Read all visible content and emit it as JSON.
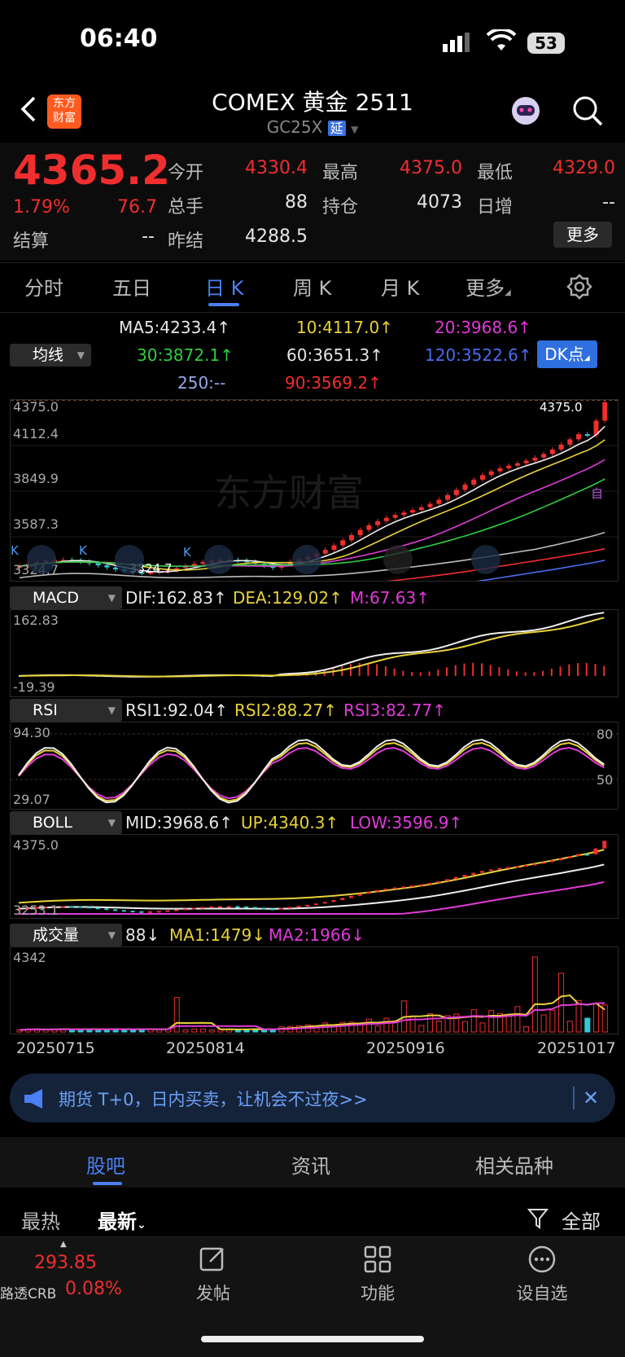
{
  "status": {
    "time": "06:40",
    "battery": "53"
  },
  "header": {
    "title": "COMEX 黄金 2511",
    "code": "GC25X",
    "delay_badge": "延",
    "logo_text": "东方\n财富"
  },
  "quote": {
    "last": "4365.2",
    "change_pct": "1.79%",
    "change": "76.7",
    "open_label": "今开",
    "open": "4330.4",
    "high_label": "最高",
    "high": "4375.0",
    "low_label": "最低",
    "low": "4329.0",
    "volume_label": "总手",
    "volume": "88",
    "oi_label": "持仓",
    "oi": "4073",
    "daily_inc_label": "日增",
    "daily_inc": "--",
    "settle_label": "结算",
    "settle": "--",
    "prev_settle_label": "昨结",
    "prev_settle": "4288.5",
    "more_button": "更多"
  },
  "tabs": [
    "分时",
    "五日",
    "日 K",
    "周 K",
    "月 K",
    "更多"
  ],
  "active_tab": "日 K",
  "ma": {
    "selector": "均线",
    "ma5": "MA5:4233.4↑",
    "ma10": "10:4117.0↑",
    "ma20": "20:3968.6↑",
    "ma30": "30:3872.1↑",
    "ma60": "60:3651.3↑",
    "ma120": "120:3522.6↑",
    "ma250": "250:--",
    "ma90": "90:3569.2↑",
    "dk_button": "DK点"
  },
  "main_chart": {
    "ticks": [
      "4375.0",
      "4112.4",
      "3849.9",
      "3587.3",
      "3324.7"
    ],
    "high_marker": "4375.0",
    "low_marker": "3324.7",
    "watermark": "东方财富",
    "tag_self": "自",
    "k_tags": [
      "K",
      "K",
      "K"
    ]
  },
  "macd": {
    "selector": "MACD",
    "dif": "DIF:162.83↑",
    "dea": "DEA:129.02↑",
    "m": "M:67.63↑",
    "ticks": [
      "162.83",
      "-19.39"
    ]
  },
  "rsi": {
    "selector": "RSI",
    "rsi1": "RSI1:92.04↑",
    "rsi2": "RSI2:88.27↑",
    "rsi3": "RSI3:82.77↑",
    "ticks": [
      "94.30",
      "29.07"
    ],
    "right_ticks": [
      "80",
      "50"
    ]
  },
  "boll": {
    "selector": "BOLL",
    "mid": "MID:3968.6↑",
    "up": "UP:4340.3↑",
    "low": "LOW:3596.9↑",
    "ticks": [
      "4375.0",
      "3253.1"
    ]
  },
  "vol": {
    "selector": "成交量",
    "v": "88↓",
    "ma1": "MA1:1479↓",
    "ma2": "MA2:1966↓",
    "ticks": [
      "4342"
    ]
  },
  "dates": [
    "20250715",
    "20250814",
    "20250916",
    "20251017"
  ],
  "banner": {
    "text": "期货 T+0，日内买卖，让机会不过夜>>"
  },
  "bottom_tabs": [
    "股吧",
    "资讯",
    "相关品种"
  ],
  "sort": {
    "hot": "最热",
    "latest": "最新",
    "filter": "全部"
  },
  "nav": {
    "crb_value": "293.85",
    "crb_name": "路透CRB",
    "crb_pct": "0.08%",
    "post": "发帖",
    "func": "功能",
    "watch": "设自选"
  }
}
